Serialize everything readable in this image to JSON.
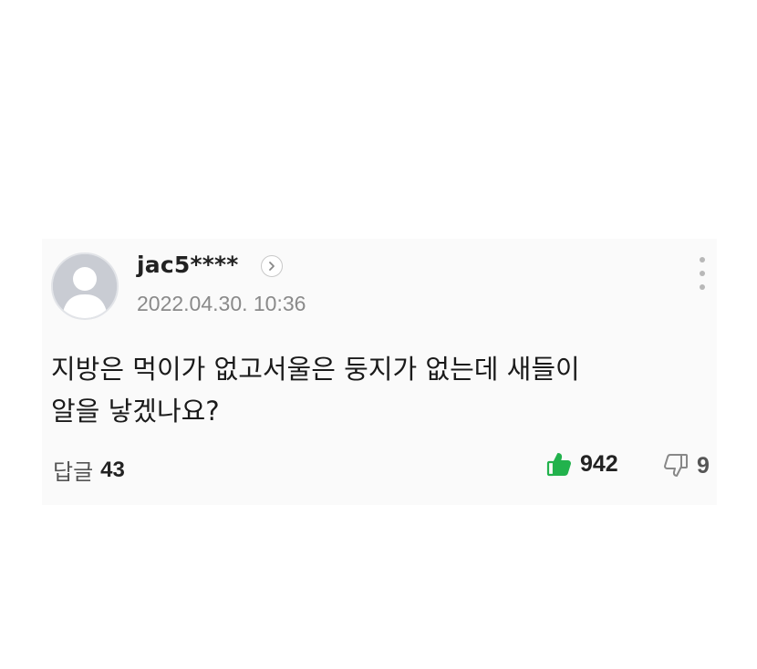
{
  "comment": {
    "username": "jac5****",
    "timestamp": "2022.04.30. 10:36",
    "text": "지방은 먹이가 없고서울은 둥지가 없는데 새들이\n알을 낳겠나요?",
    "reply_label": "답글",
    "reply_count": "43",
    "like_count": "942",
    "dislike_count": "9"
  },
  "icons": {
    "avatar": "default-user-avatar",
    "profile_link": "chevron-right-icon",
    "more": "vertical-ellipsis-icon",
    "like": "thumbs-up-icon",
    "dislike": "thumbs-down-icon"
  },
  "colors": {
    "like_accent": "#22b24c",
    "muted_text": "#8a8a8a",
    "avatar_bg": "#c9ccd3"
  }
}
